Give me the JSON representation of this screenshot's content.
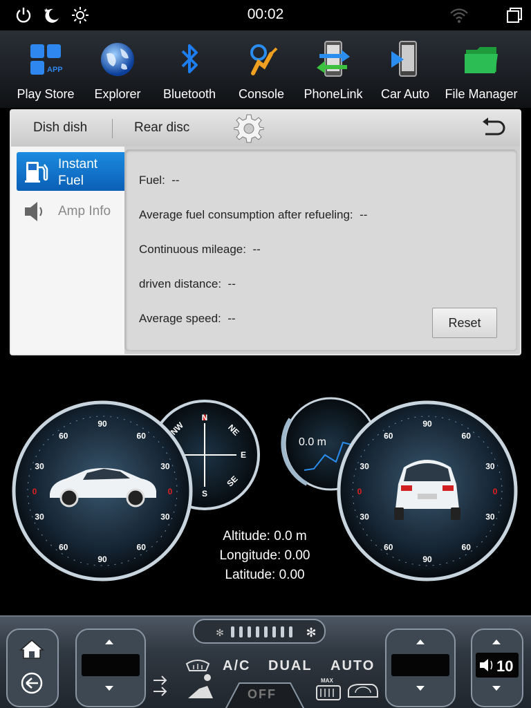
{
  "status": {
    "time": "00:02",
    "icons": [
      "power-icon",
      "night-mode-icon",
      "brightness-icon",
      "wifi-icon",
      "recent-apps-icon"
    ]
  },
  "dock": {
    "items": [
      {
        "label": "Play Store",
        "icon": "app-store-icon"
      },
      {
        "label": "Explorer",
        "icon": "globe-icon"
      },
      {
        "label": "Bluetooth",
        "icon": "bluetooth-icon"
      },
      {
        "label": "Console",
        "icon": "console-icon"
      },
      {
        "label": "PhoneLink",
        "icon": "phonelink-icon"
      },
      {
        "label": "Car Auto",
        "icon": "car-auto-icon"
      },
      {
        "label": "File Manager",
        "icon": "folder-icon"
      }
    ],
    "app_badge": "APP"
  },
  "panel": {
    "tabs": [
      "Dish dish",
      "Rear disc"
    ],
    "sidebar": [
      {
        "label_line1": "Instant",
        "label_line2": "Fuel",
        "icon": "fuel-pump-icon",
        "active": true
      },
      {
        "label_line1": "Amp Info",
        "label_line2": "",
        "icon": "speaker-icon",
        "active": false
      }
    ],
    "rows": [
      {
        "label": "Fuel:",
        "value": "--"
      },
      {
        "label": "Average fuel consumption after refueling:",
        "value": "--"
      },
      {
        "label": "Continuous mileage:",
        "value": "--"
      },
      {
        "label": "driven distance:",
        "value": "--"
      },
      {
        "label": "Average speed:",
        "value": "--"
      }
    ],
    "reset_label": "Reset"
  },
  "dashboard": {
    "left_gauge_ticks": [
      "90",
      "60",
      "60",
      "30",
      "30",
      "0",
      "0",
      "30",
      "30",
      "60",
      "60",
      "90"
    ],
    "right_gauge_ticks": [
      "90",
      "60",
      "60",
      "30",
      "30",
      "0",
      "0",
      "30",
      "30",
      "60",
      "60",
      "90"
    ],
    "compass": {
      "N": "N",
      "NE": "NE",
      "E": "E",
      "SE": "SE",
      "S": "S",
      "NW": "NW"
    },
    "altimeter_reading": "0.0 m",
    "altitude": "Altitude: 0.0 m",
    "longitude": "Longitude: 0.00",
    "latitude": "Latitude: 0.00"
  },
  "climate": {
    "ac": "A/C",
    "dual": "DUAL",
    "auto": "AUTO",
    "off": "OFF",
    "max": "MAX",
    "volume": "10"
  },
  "colors": {
    "accent_blue": "#1b8be0",
    "gauge_red": "#e02020",
    "gauge_ring": "#c8d4de"
  }
}
